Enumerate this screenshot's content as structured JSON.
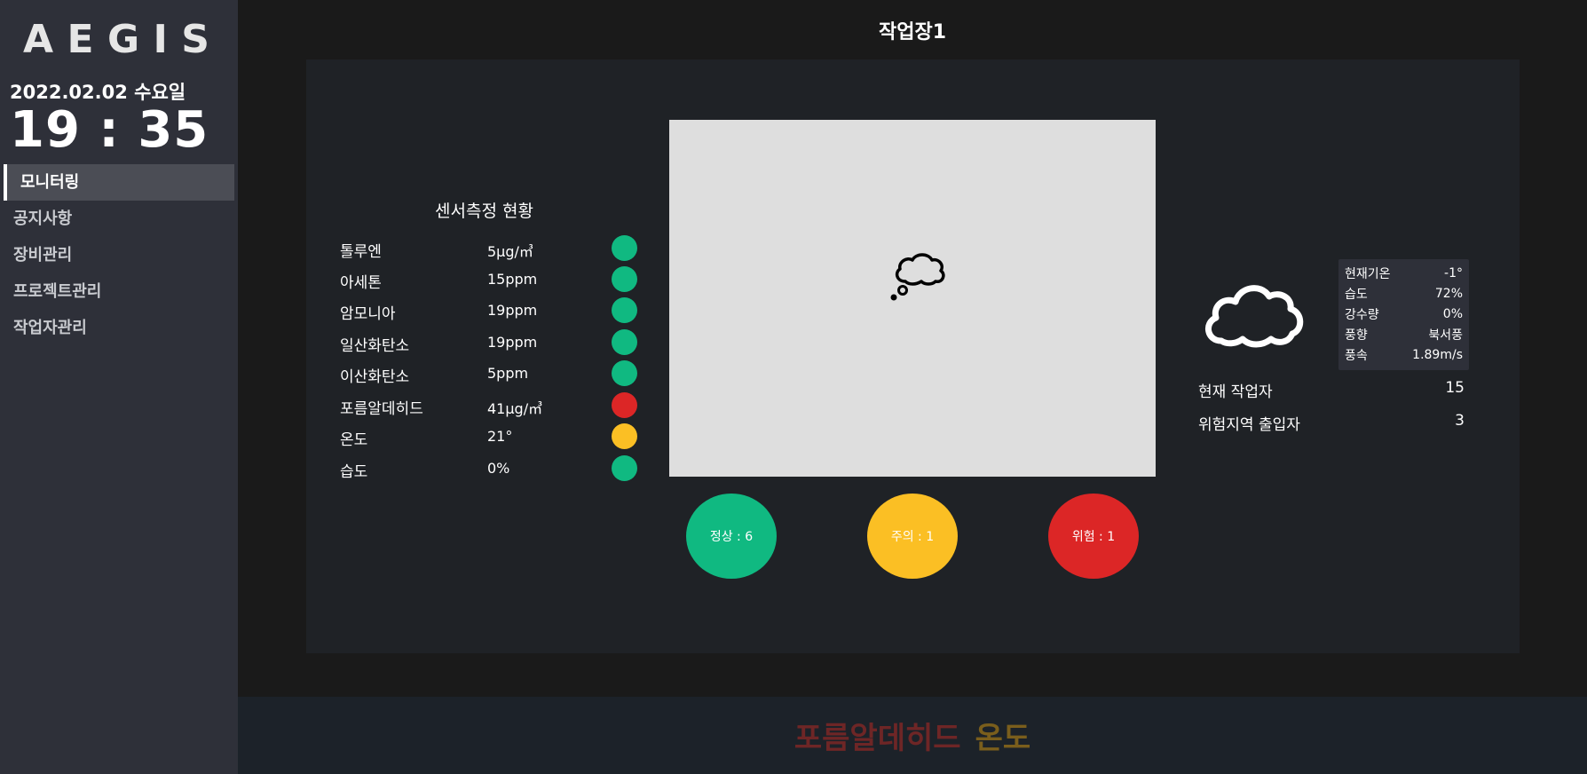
{
  "app": {
    "logo_letters": [
      "A",
      "E",
      "G",
      "I",
      "S"
    ],
    "date": "2022.02.02 수요일",
    "time": "19 : 35"
  },
  "nav": {
    "items": [
      {
        "label": "모니터링",
        "active": true
      },
      {
        "label": "공지사항",
        "active": false
      },
      {
        "label": "장비관리",
        "active": false
      },
      {
        "label": "프로젝트관리",
        "active": false
      },
      {
        "label": "작업자관리",
        "active": false
      }
    ]
  },
  "header": {
    "title": "작업장1"
  },
  "sensors": {
    "title": "센서측정 현황",
    "rows": [
      {
        "name": "톨루엔",
        "value": "5μg/㎥",
        "status": "normal"
      },
      {
        "name": "아세톤",
        "value": "15ppm",
        "status": "normal"
      },
      {
        "name": "암모니아",
        "value": "19ppm",
        "status": "normal"
      },
      {
        "name": "일산화탄소",
        "value": "19ppm",
        "status": "normal"
      },
      {
        "name": "이산화탄소",
        "value": "5ppm",
        "status": "normal"
      },
      {
        "name": "포름알데히드",
        "value": "41μg/㎥",
        "status": "danger"
      },
      {
        "name": "온도",
        "value": "21°",
        "status": "warning"
      },
      {
        "name": "습도",
        "value": "0%",
        "status": "normal"
      }
    ]
  },
  "view": {
    "icon": "thought-cloud-icon"
  },
  "counts": [
    {
      "label": "정상 : 6",
      "status": "normal"
    },
    {
      "label": "주의 : 1",
      "status": "warning"
    },
    {
      "label": "위험 : 1",
      "status": "danger"
    }
  ],
  "weather": {
    "icon": "cloud-icon",
    "rows": [
      {
        "label": "현재기온",
        "value": "-1°"
      },
      {
        "label": "습도",
        "value": "72%"
      },
      {
        "label": "강수량",
        "value": "0%"
      },
      {
        "label": "풍향",
        "value": "북서풍"
      },
      {
        "label": "풍속",
        "value": "1.89m/s"
      }
    ]
  },
  "workers": {
    "current_label": "현재 작업자",
    "current_value": "15",
    "danger_zone_label": "위험지역 출입자",
    "danger_zone_value": "3"
  },
  "alert_footer": {
    "items": [
      {
        "text": "포름알데히드",
        "color": "#6e2626"
      },
      {
        "text": "온도",
        "color": "#7a5e1c"
      }
    ]
  },
  "colors": {
    "normal": "#10b981",
    "warning": "#fbbf24",
    "danger": "#dc2626"
  }
}
